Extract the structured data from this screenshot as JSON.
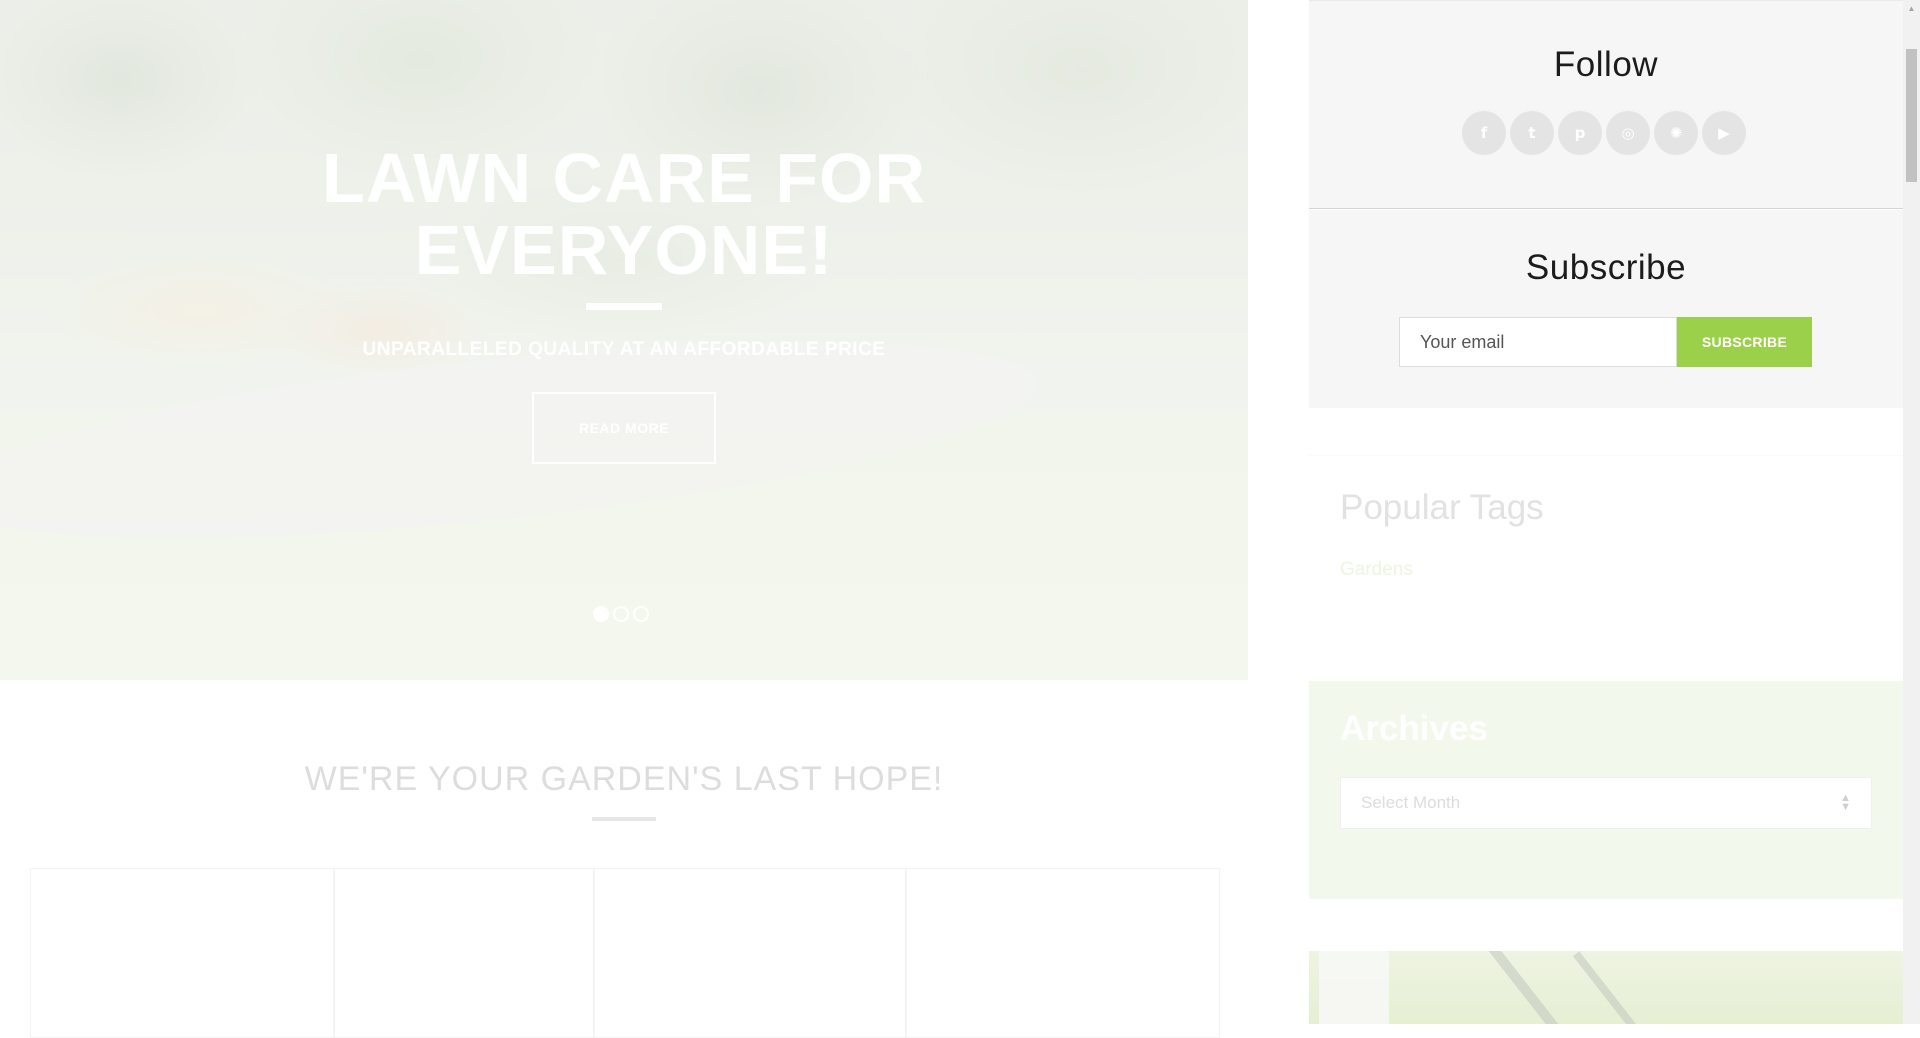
{
  "hero": {
    "title_line1": "LAWN CARE FOR",
    "title_line2": "EVERYONE!",
    "subtitle": "UNPARALLELED QUALITY AT AN AFFORDABLE PRICE",
    "button_label": "READ MORE",
    "slides": {
      "count": 3,
      "active": 1
    }
  },
  "section": {
    "title": "WE'RE YOUR GARDEN'S LAST HOPE!"
  },
  "sidebar": {
    "follow": {
      "title": "Follow",
      "icons": [
        "facebook-icon",
        "twitter-icon",
        "pinterest-icon",
        "instagram-icon",
        "dribbble-icon",
        "youtube-icon"
      ],
      "glyphs": [
        "f",
        "t",
        "p",
        "◎",
        "✺",
        "▶"
      ]
    },
    "subscribe": {
      "title": "Subscribe",
      "email_placeholder": "Your email",
      "email_value": "",
      "button_label": "SUBSCRIBE"
    },
    "tags": {
      "title": "Popular Tags",
      "items": [
        "Gardens"
      ]
    },
    "archives": {
      "title": "Archives",
      "select_value": "Select Month"
    }
  },
  "colors": {
    "accent": "#9bd04a",
    "text_dark": "#1c1c1c",
    "panel_bg": "#f6f6f6"
  }
}
